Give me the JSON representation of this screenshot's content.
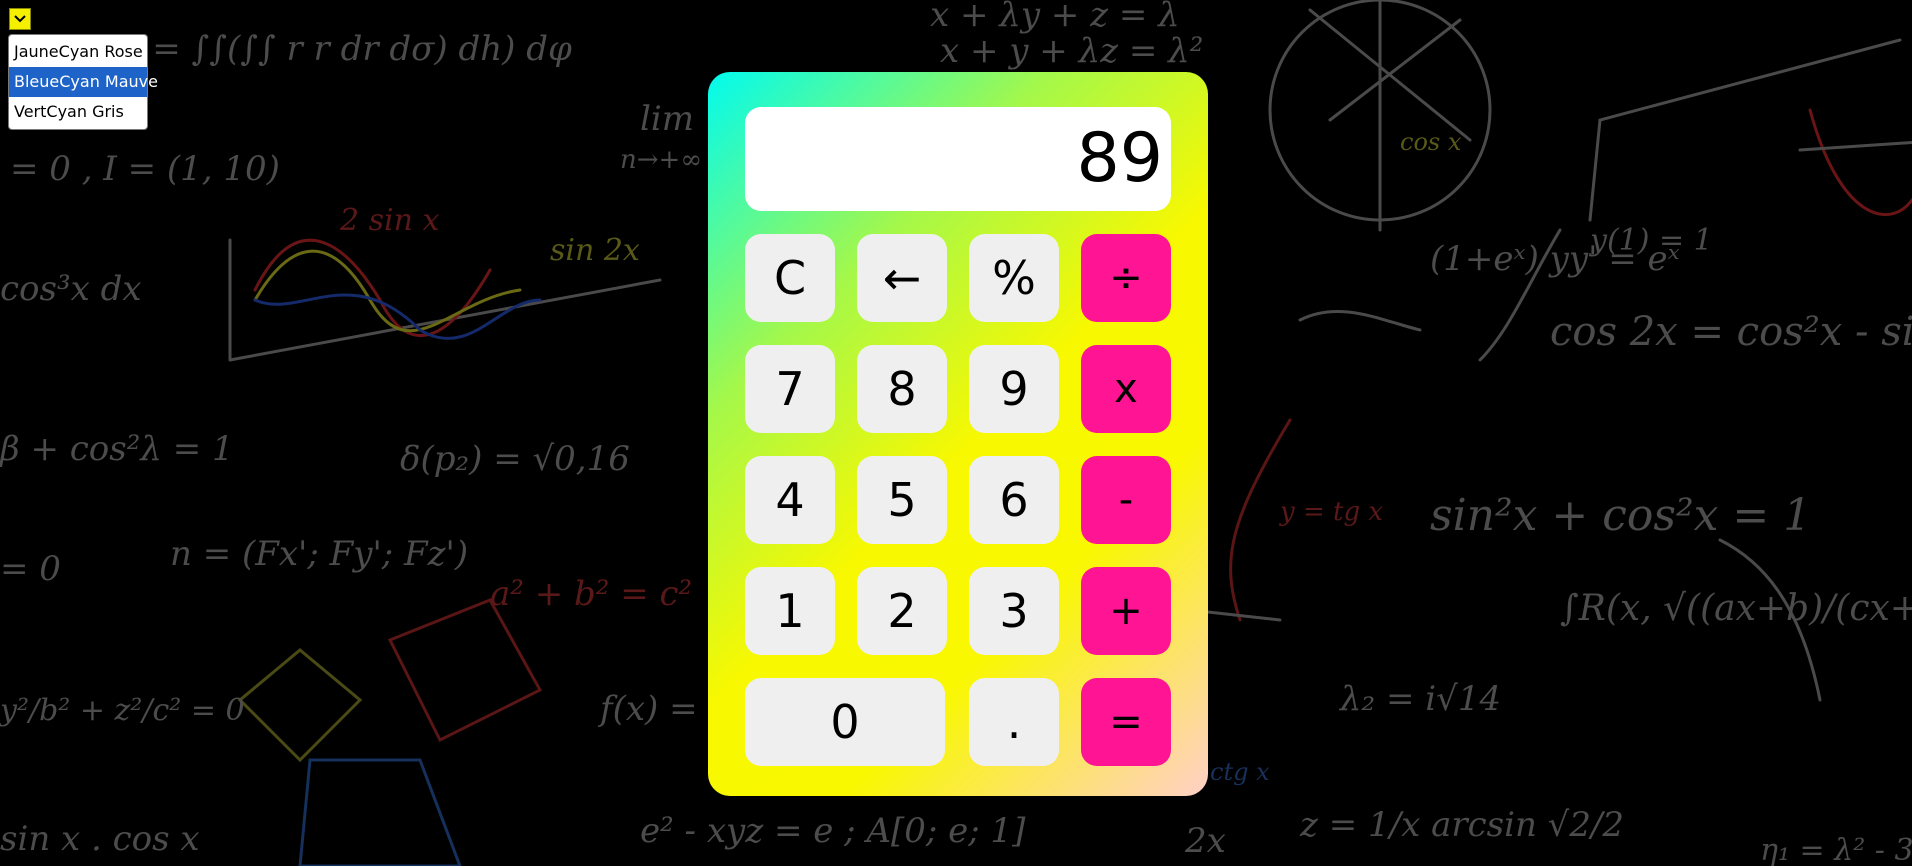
{
  "theme_menu": {
    "toggle_icon": "chevron-down-icon",
    "options": [
      {
        "label": "JauneCyan Rose",
        "selected": false
      },
      {
        "label": "BleueCyan Mauve",
        "selected": true
      },
      {
        "label": "VertCyan Gris",
        "selected": false
      }
    ]
  },
  "calculator": {
    "display": "89",
    "keys": {
      "clear": "C",
      "backspace": "←",
      "percent": "%",
      "divide": "÷",
      "seven": "7",
      "eight": "8",
      "nine": "9",
      "multiply": "x",
      "four": "4",
      "five": "5",
      "six": "6",
      "subtract": "-",
      "one": "1",
      "two": "2",
      "three": "3",
      "add": "+",
      "zero": "0",
      "decimal": ".",
      "equals": "="
    }
  },
  "background": {
    "formulas": [
      "x dy dz = ∫∫(∫∫ r r dr dσ) dh) dφ",
      "x + λy + z = λ",
      "x + y + λz = λ²",
      "= 0 , I = (1, 10)",
      "lim",
      "n→+∞",
      "2 sin x",
      "sin 2x",
      "cos³x dx",
      "(1+eˣ) yy' = eˣ",
      "y(1) = 1",
      "cos 2x = cos²x - si",
      "β + cos²λ = 1",
      "δ(p₂) = √0,16",
      "n = (Fx'; Fy'; Fz')",
      "a² + b² = c²",
      "= 0",
      "sin²x + cos²x = 1",
      "∫R(x, √((ax+b)/(cx+d))) dx",
      "λ₂ = i√14",
      "f(x) =",
      "y²/b² + z²/c² = 0",
      "sin x . cos x",
      "e² - xyz = e ; A[0; e; 1]",
      "z = 1/x arcsin √2/2",
      "2x",
      "η₁ = λ² - 3",
      "cos x",
      "y = tg x",
      "ctg x"
    ]
  },
  "colors": {
    "operator_key": "#ff1493",
    "digit_key": "#efefef",
    "selected_option": "#1e64c8",
    "toggle": "#f4f000"
  }
}
